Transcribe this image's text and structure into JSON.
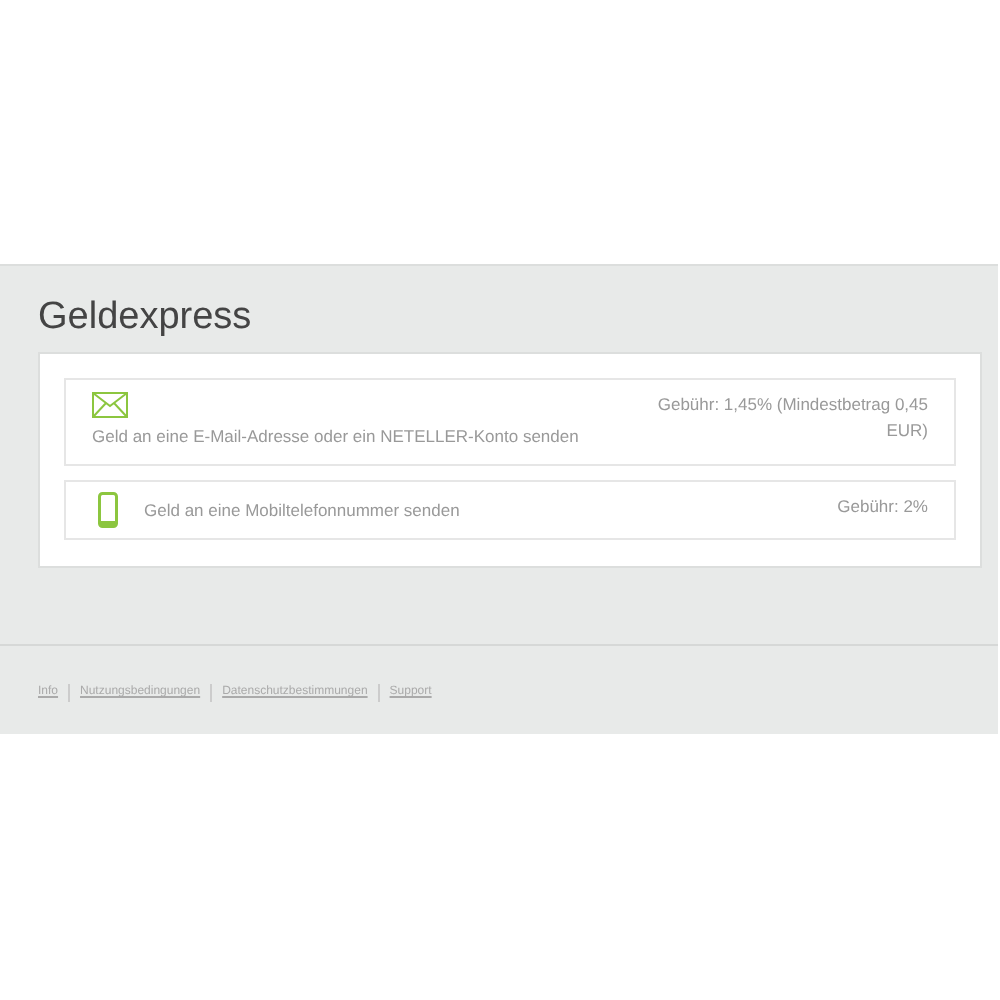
{
  "title": "Geldexpress",
  "options": [
    {
      "kind": "email",
      "label": "Geld an eine E-Mail-Adresse oder ein NETELLER-Konto senden",
      "fee": "Gebühr: 1,45% (Mindestbetrag 0,45 EUR)"
    },
    {
      "kind": "mobile",
      "label": "Geld an eine Mobiltelefonnummer senden",
      "fee": "Gebühr: 2%"
    }
  ],
  "footer_links": [
    "Info",
    "Nutzungsbedingungen",
    "Datenschutzbestimmungen",
    "Support"
  ]
}
